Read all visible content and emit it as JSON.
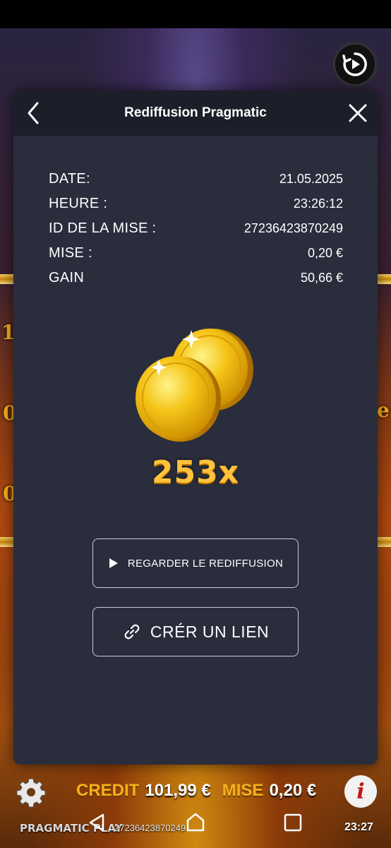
{
  "modal": {
    "title": "Rediffusion Pragmatic",
    "rows": [
      {
        "label": "DATE:",
        "value": "21.05.2025"
      },
      {
        "label": "HEURE :",
        "value": "23:26:12"
      },
      {
        "label": "ID DE LA MISE :",
        "value": "27236423870249"
      },
      {
        "label": "MISE :",
        "value": "0,20 €"
      },
      {
        "label": "GAIN",
        "value": "50,66 €"
      }
    ],
    "multiplier": "253x",
    "watch_button": "REGARDER LE REDIFFUSION",
    "link_button": "CRÉR UN LIEN"
  },
  "game_bar": {
    "credit_label": "CREDIT",
    "credit_value": "101,99 €",
    "bet_label": "MISE",
    "bet_value": "0,20 €",
    "brand": "PRAGMATIC PLAY",
    "bet_id": "27236423870249",
    "time": "23:27"
  },
  "background": {
    "side_numbers_left": [
      "1.",
      "0",
      "0"
    ],
    "side_letter_right": "e"
  },
  "icons": {
    "replay": "replay-icon",
    "back": "chevron-left-icon",
    "close": "close-icon",
    "play": "play-icon",
    "link": "link-icon",
    "settings": "gear-icon",
    "info": "info-icon",
    "coins": "gold-coins-icon"
  },
  "colors": {
    "modal_bg": "#2a2d3c",
    "header_bg": "#1c1f2a",
    "gold": "#ffc23a",
    "credit_gold": "#f5b01a"
  }
}
